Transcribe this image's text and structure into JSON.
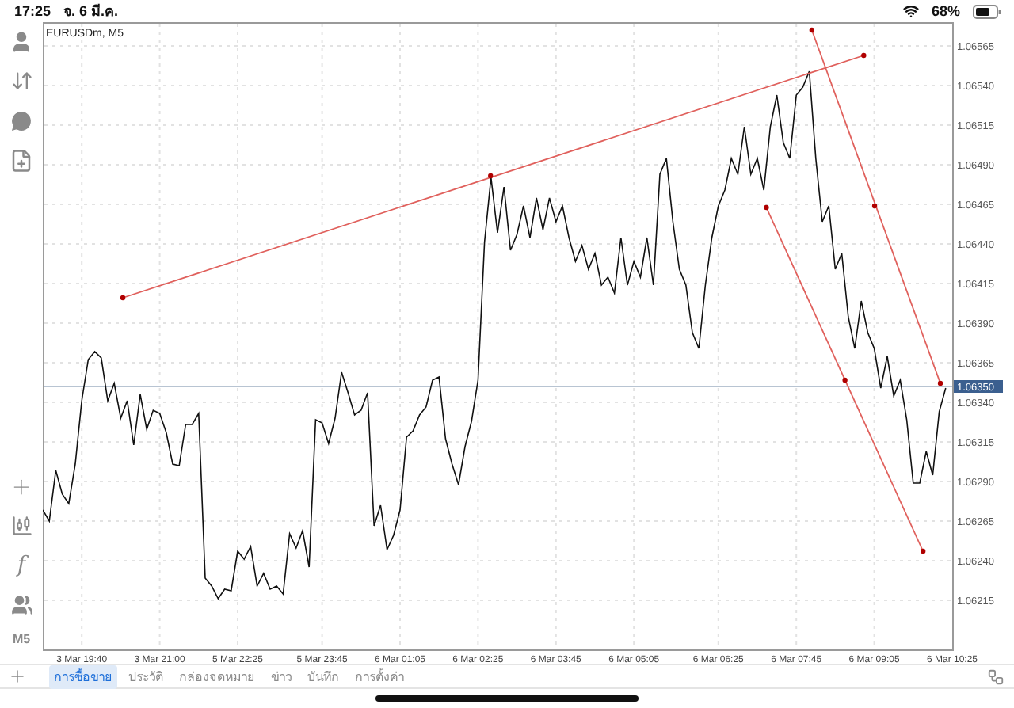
{
  "status_bar": {
    "time": "17:25",
    "date": "จ. 6 มี.ค.",
    "battery": "68%"
  },
  "toolbar": {
    "function_glyph": "f",
    "timeframe": "M5"
  },
  "chart": {
    "title": "EURUSDm, M5",
    "chart_data": {
      "type": "line",
      "categories": [
        null,
        null,
        null,
        null,
        null,
        null,
        "3 Mar 19:40",
        null,
        null,
        null,
        null,
        null,
        null,
        null,
        null,
        null,
        null,
        null,
        "3 Mar 21:00",
        null,
        null,
        null,
        null,
        null,
        null,
        null,
        null,
        null,
        null,
        null,
        "5 Mar 22:25",
        null,
        null,
        null,
        null,
        null,
        null,
        null,
        null,
        null,
        null,
        null,
        null,
        "5 Mar 23:45",
        null,
        null,
        null,
        null,
        null,
        null,
        null,
        null,
        null,
        null,
        null,
        "6 Mar 01:05",
        null,
        null,
        null,
        null,
        null,
        null,
        null,
        null,
        null,
        null,
        null,
        "6 Mar 02:25",
        null,
        null,
        null,
        null,
        null,
        null,
        null,
        null,
        null,
        null,
        null,
        "6 Mar 03:45",
        null,
        null,
        null,
        null,
        null,
        null,
        null,
        null,
        null,
        null,
        null,
        "6 Mar 05:05",
        null,
        null,
        null,
        null,
        null,
        null,
        null,
        null,
        null,
        null,
        null,
        null,
        "6 Mar 06:25",
        null,
        null,
        null,
        null,
        null,
        null,
        null,
        null,
        null,
        null,
        null,
        "6 Mar 07:45",
        null,
        null,
        null,
        null,
        null,
        null,
        null,
        null,
        null,
        null,
        null,
        "6 Mar 09:05",
        null,
        null,
        null,
        null,
        null,
        null,
        null,
        null,
        null,
        null,
        null,
        "6 Mar 10:25"
      ],
      "series": [
        {
          "color": "#111111",
          "values": [
            1.06272,
            1.06265,
            1.06297,
            1.06282,
            1.06276,
            1.06301,
            1.06341,
            1.06367,
            1.06372,
            1.06368,
            1.06341,
            1.06352,
            1.0633,
            1.06341,
            1.06313,
            1.06345,
            1.06323,
            1.06335,
            1.06333,
            1.06321,
            1.06301,
            1.063,
            1.06326,
            1.06326,
            1.06333,
            1.06229,
            1.06224,
            1.06216,
            1.06222,
            1.06221,
            1.06246,
            1.06241,
            1.06249,
            1.06224,
            1.06232,
            1.06222,
            1.06224,
            1.06219,
            1.06257,
            1.06248,
            1.06259,
            1.06236,
            1.06329,
            1.06327,
            1.06314,
            1.0633,
            1.06359,
            1.06346,
            1.06332,
            1.06335,
            1.06346,
            1.06262,
            1.06275,
            1.06247,
            1.06256,
            1.06272,
            1.06318,
            1.06322,
            1.06332,
            1.06337,
            1.06354,
            1.06356,
            1.06317,
            1.06301,
            1.06288,
            1.06312,
            1.06328,
            1.06354,
            1.06441,
            1.06482,
            1.06447,
            1.06476,
            1.06436,
            1.06446,
            1.06464,
            1.06444,
            1.06469,
            1.06449,
            1.06469,
            1.06454,
            1.06464,
            1.06444,
            1.06429,
            1.06439,
            1.06424,
            1.06434,
            1.06414,
            1.06419,
            1.06409,
            1.06444,
            1.06414,
            1.06429,
            1.06419,
            1.06444,
            1.06414,
            1.06484,
            1.06494,
            1.06454,
            1.06424,
            1.06414,
            1.06384,
            1.06374,
            1.06414,
            1.06444,
            1.06464,
            1.06474,
            1.06494,
            1.06484,
            1.06514,
            1.06484,
            1.06494,
            1.06474,
            1.06514,
            1.06534,
            1.06504,
            1.06494,
            1.06534,
            1.06539,
            1.06549,
            1.06494,
            1.06454,
            1.06464,
            1.06424,
            1.06434,
            1.06394,
            1.06374,
            1.06404,
            1.06384,
            1.06374,
            1.06349,
            1.06369,
            1.06344,
            1.06354,
            1.06329,
            1.06289,
            1.06289,
            1.06309,
            1.06294,
            1.06334,
            1.06349,
            null
          ]
        }
      ],
      "ylim": [
        1.06184,
        1.0658
      ],
      "grid": true,
      "ref_lines": [
        {
          "axis": "y",
          "value": 1.0635,
          "label": "1.06350"
        }
      ],
      "yticks": [
        {
          "value": 1.06565,
          "label": "1.06565"
        },
        {
          "value": 1.0654,
          "label": "1.06540"
        },
        {
          "value": 1.06515,
          "label": "1.06515"
        },
        {
          "value": 1.0649,
          "label": "1.06490"
        },
        {
          "value": 1.06465,
          "label": "1.06465"
        },
        {
          "value": 1.0644,
          "label": "1.06440"
        },
        {
          "value": 1.06415,
          "label": "1.06415"
        },
        {
          "value": 1.0639,
          "label": "1.06390"
        },
        {
          "value": 1.06365,
          "label": "1.06365"
        },
        {
          "value": 1.0634,
          "label": "1.06340"
        },
        {
          "value": 1.06315,
          "label": "1.06315"
        },
        {
          "value": 1.0629,
          "label": "1.06290"
        },
        {
          "value": 1.06265,
          "label": "1.06265"
        },
        {
          "value": 1.0624,
          "label": "1.06240"
        },
        {
          "value": 1.06215,
          "label": "1.06215"
        }
      ]
    }
  },
  "tabs": [
    {
      "label": "การซื้อขาย",
      "selected": true
    },
    {
      "label": "ประวัติ",
      "selected": false
    },
    {
      "label": "กล่องจดหมาย",
      "selected": false
    },
    {
      "label": "ข่าว",
      "selected": false
    },
    {
      "label": "บันทึก",
      "selected": false
    },
    {
      "label": "การตั้งค่า",
      "selected": false
    }
  ]
}
